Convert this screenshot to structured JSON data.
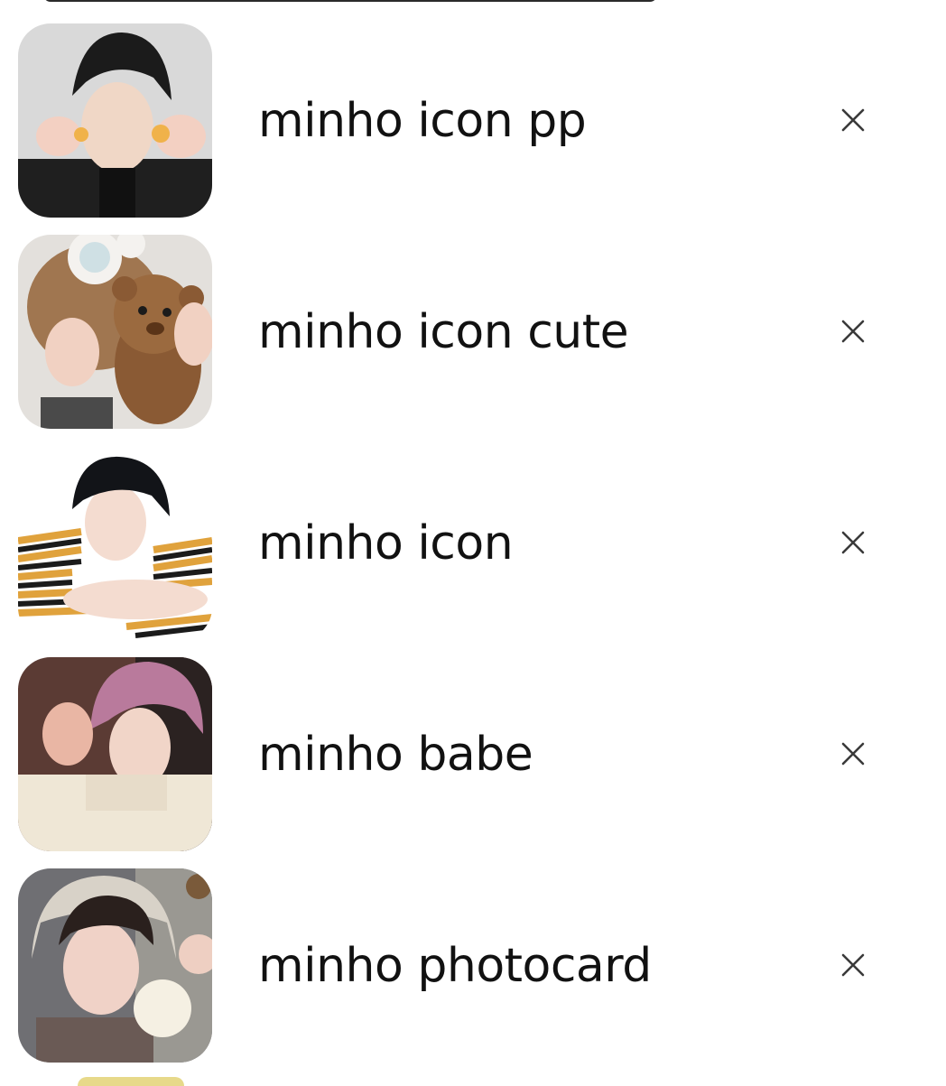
{
  "recent_searches": [
    {
      "query": "minho icon pp",
      "icon": "thumbnail-image",
      "remove_icon": "close-icon"
    },
    {
      "query": "minho icon cute",
      "icon": "thumbnail-image",
      "remove_icon": "close-icon"
    },
    {
      "query": "minho icon",
      "icon": "thumbnail-image",
      "remove_icon": "close-icon"
    },
    {
      "query": "minho babe",
      "icon": "thumbnail-image",
      "remove_icon": "close-icon"
    },
    {
      "query": "minho photocard",
      "icon": "thumbnail-image",
      "remove_icon": "close-icon"
    }
  ],
  "colors": {
    "background": "#ffffff",
    "text": "#111111",
    "close": "#3a3a3a"
  }
}
